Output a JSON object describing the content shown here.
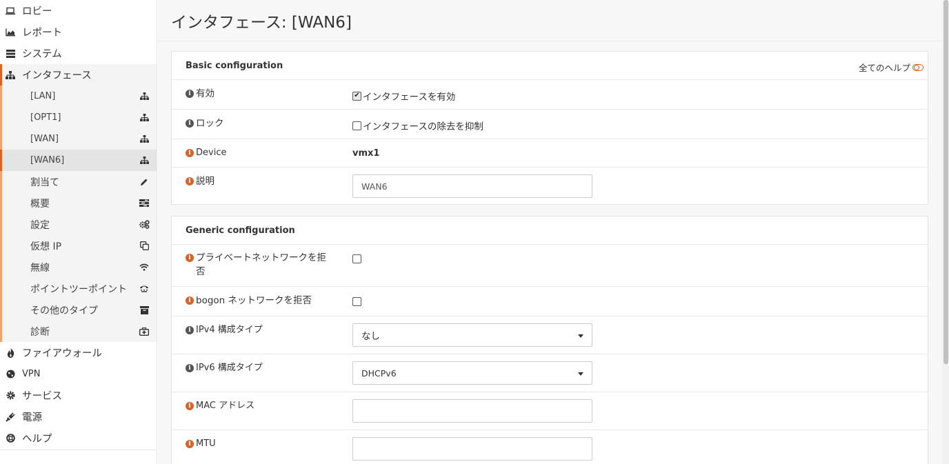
{
  "sidebar": {
    "items": [
      {
        "label": "ロビー",
        "icon": "laptop-icon"
      },
      {
        "label": "レポート",
        "icon": "area-chart-icon"
      },
      {
        "label": "システム",
        "icon": "server-icon"
      },
      {
        "label": "インタフェース",
        "icon": "sitemap-icon"
      }
    ],
    "interfaces": [
      {
        "label": "[LAN]",
        "icon": "sitemap-icon"
      },
      {
        "label": "[OPT1]",
        "icon": "sitemap-icon"
      },
      {
        "label": "[WAN]",
        "icon": "sitemap-icon"
      },
      {
        "label": "[WAN6]",
        "icon": "sitemap-icon"
      },
      {
        "label": "割当て",
        "icon": "pencil-icon"
      },
      {
        "label": "概要",
        "icon": "tasks-icon"
      },
      {
        "label": "設定",
        "icon": "cogs-icon"
      },
      {
        "label": "仮想 IP",
        "icon": "clone-icon"
      },
      {
        "label": "無線",
        "icon": "wifi-icon"
      },
      {
        "label": "ポイントツーポイント",
        "icon": "tty-icon"
      },
      {
        "label": "その他のタイプ",
        "icon": "archive-icon"
      },
      {
        "label": "診断",
        "icon": "medkit-icon"
      }
    ],
    "bottom": [
      {
        "label": "ファイアウォール",
        "icon": "fire-icon"
      },
      {
        "label": "VPN",
        "icon": "globe-icon"
      },
      {
        "label": "サービス",
        "icon": "cog-icon"
      },
      {
        "label": "電源",
        "icon": "plug-icon"
      },
      {
        "label": "ヘルプ",
        "icon": "life-ring-icon"
      }
    ]
  },
  "page": {
    "title": "インタフェース: [WAN6]"
  },
  "basic": {
    "heading": "Basic configuration",
    "help_label": "全てのヘルプ",
    "enable_label": "有効",
    "enable_check": "インタフェースを有効",
    "lock_label": "ロック",
    "lock_check": "インタフェースの除去を抑制",
    "device_label": "Device",
    "device_value": "vmx1",
    "desc_label": "説明",
    "desc_value": "WAN6"
  },
  "generic": {
    "heading": "Generic configuration",
    "private_label": "プライベートネットワークを拒否",
    "bogon_label": "bogon ネットワークを拒否",
    "ipv4_label": "IPv4 構成タイプ",
    "ipv4_value": "なし",
    "ipv6_label": "IPv6 構成タイプ",
    "ipv6_value": "DHCPv6",
    "mac_label": "MAC アドレス",
    "mac_value": "",
    "mtu_label": "MTU",
    "mtu_value": ""
  },
  "colors": {
    "accent": "#e0631d",
    "accent_light": "#f2a36a",
    "info_orange": "#d9622a"
  }
}
